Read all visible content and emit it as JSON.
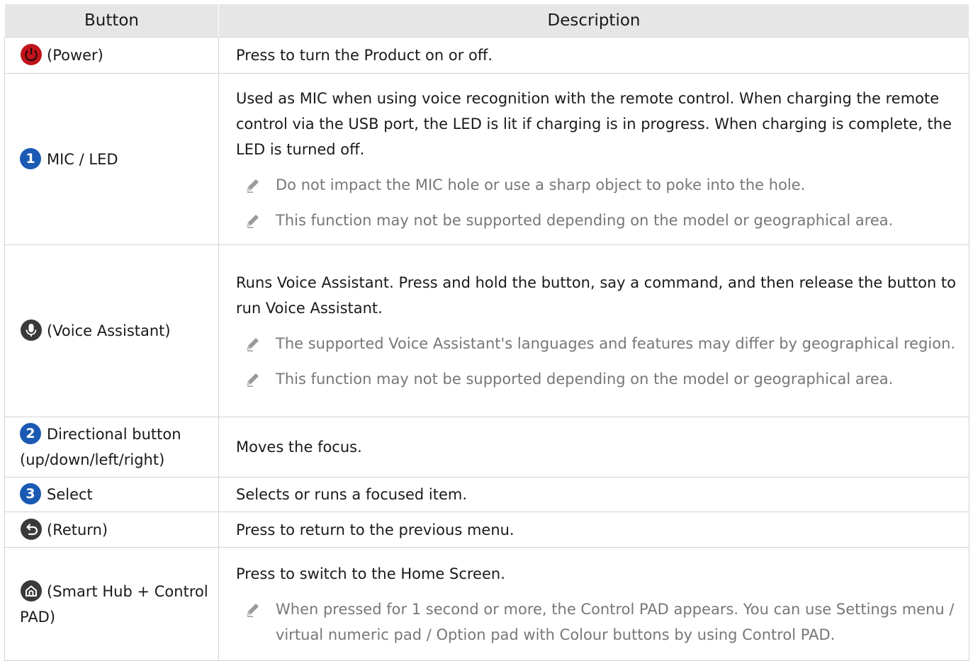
{
  "table": {
    "headers": {
      "button": "Button",
      "description": "Description"
    },
    "rows": [
      {
        "icon": "power-icon",
        "button": "(Power)",
        "description": "Press to turn the Product on or off.",
        "notes": []
      },
      {
        "marker": "1",
        "button": "MIC / LED",
        "description": "Used as MIC when using voice recognition with the remote control. When charging the remote control via the USB port, the LED is lit if charging is in progress. When charging is complete, the LED is turned off.",
        "notes": [
          "Do not impact the MIC hole or use a sharp object to poke into the hole.",
          "This function may not be supported depending on the model or geographical area."
        ]
      },
      {
        "icon": "microphone-icon",
        "button": "(Voice Assistant)",
        "description": "Runs Voice Assistant. Press and hold the button, say a command, and then release the button to run Voice Assistant.",
        "notes": [
          "The supported Voice Assistant's languages and features may differ by geographical region.",
          "This function may not be supported depending on the model or geographical area."
        ]
      },
      {
        "marker": "2",
        "button": "Directional button (up/down/left/right)",
        "description": "Moves the focus.",
        "notes": []
      },
      {
        "marker": "3",
        "button": "Select",
        "description": "Selects or runs a focused item.",
        "notes": []
      },
      {
        "icon": "return-icon",
        "button": "(Return)",
        "description": "Press to return to the previous menu.",
        "notes": []
      },
      {
        "icon": "home-icon",
        "button": "(Smart Hub + Control PAD)",
        "description": "Press to switch to the Home Screen.",
        "notes": [
          "When pressed for 1 second or more, the Control PAD appears. You can use Settings menu / virtual numeric pad / Option pad with Colour buttons by using Control PAD."
        ]
      }
    ]
  },
  "colors": {
    "header_bg": "#e6e6e6",
    "border": "#d4d4d4",
    "marker_blue": "#1a5ab3",
    "power_red": "#c0141b",
    "icon_dark": "#3a3a3a",
    "note_gray": "#777777",
    "pencil_gray": "#9a9a9a"
  }
}
